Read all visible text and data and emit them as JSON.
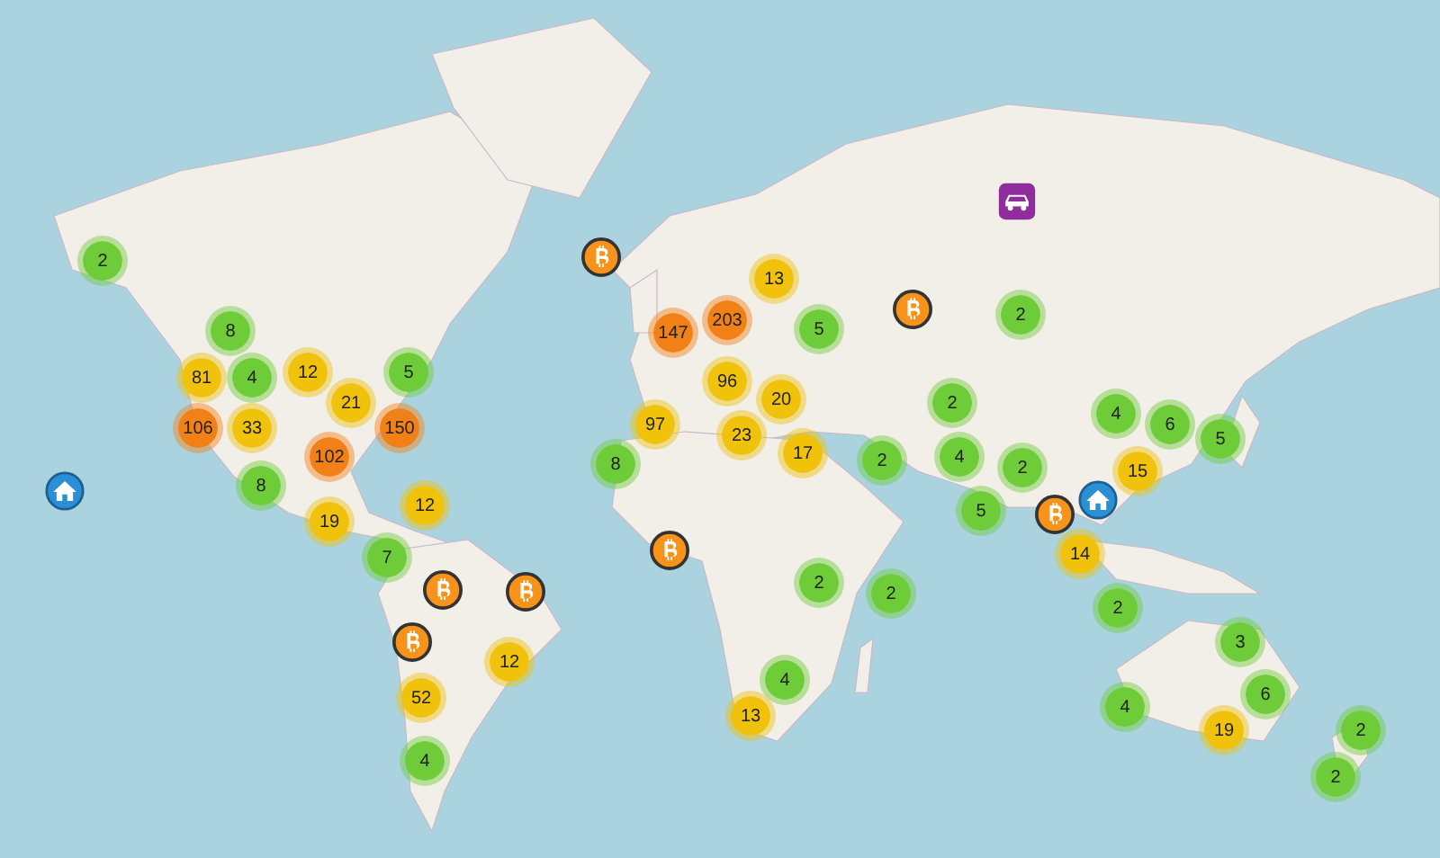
{
  "map": {
    "clusters": [
      {
        "count": "2",
        "color": "#6ecc39"
      },
      {
        "count": "8",
        "color": "#6ecc39"
      },
      {
        "count": "81",
        "color": "#f0c20c"
      },
      {
        "count": "4",
        "color": "#6ecc39"
      },
      {
        "count": "12",
        "color": "#f0c20c"
      },
      {
        "count": "5",
        "color": "#6ecc39"
      },
      {
        "count": "106",
        "color": "#f18017"
      },
      {
        "count": "33",
        "color": "#f0c20c"
      },
      {
        "count": "21",
        "color": "#f0c20c"
      },
      {
        "count": "150",
        "color": "#f18017"
      },
      {
        "count": "102",
        "color": "#f18017"
      },
      {
        "count": "8",
        "color": "#6ecc39"
      },
      {
        "count": "19",
        "color": "#f0c20c"
      },
      {
        "count": "12",
        "color": "#f0c20c"
      },
      {
        "count": "7",
        "color": "#6ecc39"
      },
      {
        "count": "12",
        "color": "#f0c20c"
      },
      {
        "count": "52",
        "color": "#f0c20c"
      },
      {
        "count": "4",
        "color": "#6ecc39"
      },
      {
        "count": "13",
        "color": "#f0c20c"
      },
      {
        "count": "203",
        "color": "#f18017"
      },
      {
        "count": "147",
        "color": "#f18017"
      },
      {
        "count": "5",
        "color": "#6ecc39"
      },
      {
        "count": "96",
        "color": "#f0c20c"
      },
      {
        "count": "20",
        "color": "#f0c20c"
      },
      {
        "count": "97",
        "color": "#f0c20c"
      },
      {
        "count": "23",
        "color": "#f0c20c"
      },
      {
        "count": "17",
        "color": "#f0c20c"
      },
      {
        "count": "8",
        "color": "#6ecc39"
      },
      {
        "count": "2",
        "color": "#6ecc39"
      },
      {
        "count": "2",
        "color": "#6ecc39"
      },
      {
        "count": "4",
        "color": "#6ecc39"
      },
      {
        "count": "2",
        "color": "#6ecc39"
      },
      {
        "count": "2",
        "color": "#6ecc39"
      },
      {
        "count": "5",
        "color": "#6ecc39"
      },
      {
        "count": "4",
        "color": "#6ecc39"
      },
      {
        "count": "6",
        "color": "#6ecc39"
      },
      {
        "count": "5",
        "color": "#6ecc39"
      },
      {
        "count": "15",
        "color": "#f0c20c"
      },
      {
        "count": "14",
        "color": "#f0c20c"
      },
      {
        "count": "2",
        "color": "#6ecc39"
      },
      {
        "count": "2",
        "color": "#6ecc39"
      },
      {
        "count": "2",
        "color": "#6ecc39"
      },
      {
        "count": "3",
        "color": "#6ecc39"
      },
      {
        "count": "4",
        "color": "#6ecc39"
      },
      {
        "count": "13",
        "color": "#f0c20c"
      },
      {
        "count": "4",
        "color": "#6ecc39"
      },
      {
        "count": "6",
        "color": "#6ecc39"
      },
      {
        "count": "19",
        "color": "#f0c20c"
      },
      {
        "count": "2",
        "color": "#6ecc39"
      },
      {
        "count": "2",
        "color": "#6ecc39"
      }
    ],
    "markers": [
      {
        "kind": "bitcoin"
      },
      {
        "kind": "bitcoin"
      },
      {
        "kind": "bitcoin"
      },
      {
        "kind": "bitcoin"
      },
      {
        "kind": "bitcoin"
      },
      {
        "kind": "bitcoin"
      },
      {
        "kind": "bitcoin"
      },
      {
        "kind": "home"
      },
      {
        "kind": "home"
      },
      {
        "kind": "car"
      }
    ]
  }
}
